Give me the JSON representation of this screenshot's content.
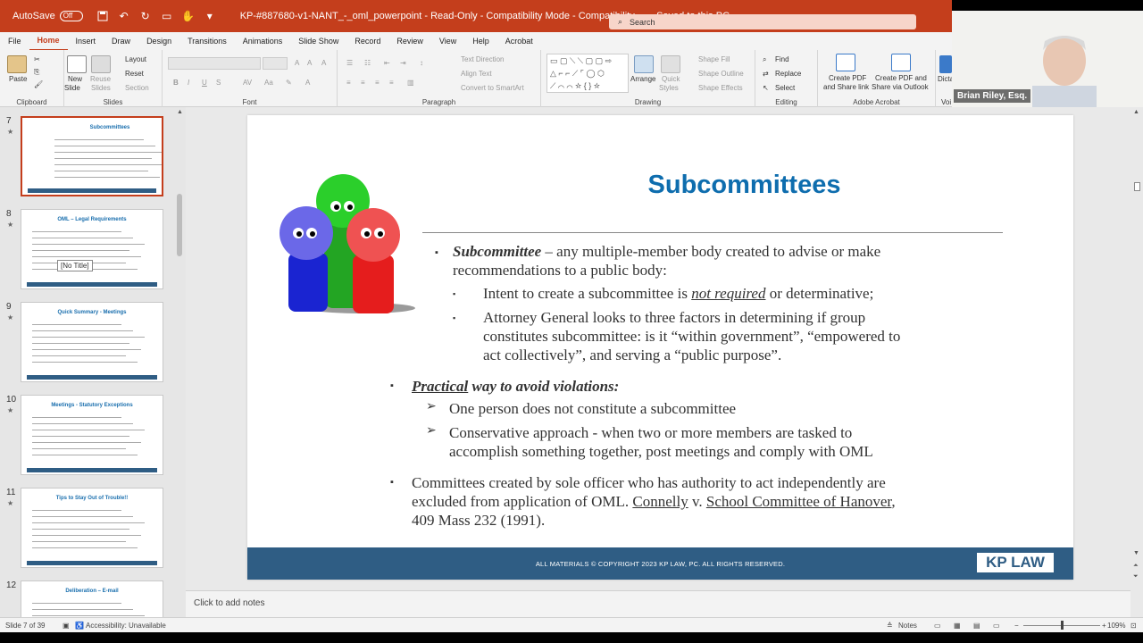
{
  "titlebar": {
    "autosave_label": "AutoSave",
    "autosave_state": "Off",
    "file_title": "KP-#887680-v1-NANT_-_oml_powerpoint  -  Read-Only  -  Compatibility Mode  -  Compatibility...",
    "saved_status": "Saved to this PC",
    "search_placeholder": "Search",
    "brand_color": "#c43e1c"
  },
  "tabs": [
    "File",
    "Home",
    "Insert",
    "Draw",
    "Design",
    "Transitions",
    "Animations",
    "Slide Show",
    "Record",
    "Review",
    "View",
    "Help",
    "Acrobat"
  ],
  "active_tab": "Home",
  "ribbon": {
    "clipboard": {
      "paste": "Paste",
      "label": "Clipboard"
    },
    "slides": {
      "new_slide_1": "New",
      "new_slide_2": "Slide",
      "reuse_1": "Reuse",
      "reuse_2": "Slides",
      "layout": "Layout",
      "reset": "Reset",
      "section": "Section",
      "label": "Slides"
    },
    "font": {
      "label": "Font"
    },
    "paragraph": {
      "text_direction": "Text Direction",
      "align_text": "Align Text",
      "convert_smartart": "Convert to SmartArt",
      "label": "Paragraph"
    },
    "drawing": {
      "arrange": "Arrange",
      "quick_styles_1": "Quick",
      "quick_styles_2": "Styles",
      "shape_fill": "Shape Fill",
      "shape_outline": "Shape Outline",
      "shape_effects": "Shape Effects",
      "label": "Drawing"
    },
    "editing": {
      "find": "Find",
      "replace": "Replace",
      "select": "Select",
      "label": "Editing"
    },
    "acrobat": {
      "create_pdf_1": "Create PDF",
      "create_pdf_2": "and Share link",
      "create_outlook_1": "Create PDF and",
      "create_outlook_2": "Share via Outlook",
      "label": "Adobe Acrobat"
    },
    "dictate": {
      "label_1": "Dicta",
      "label_2": "Voi"
    }
  },
  "video": {
    "participant_name": "Brian Riley, Esq."
  },
  "thumbnails": [
    {
      "num": "7",
      "star": "★",
      "title": "Subcommittees"
    },
    {
      "num": "8",
      "star": "★",
      "title": "OML – Legal Requirements",
      "tooltip": "[No Title]"
    },
    {
      "num": "9",
      "star": "★",
      "title": "Quick Summary - Meetings"
    },
    {
      "num": "10",
      "star": "★",
      "title": "Meetings - Statutory Exceptions"
    },
    {
      "num": "11",
      "star": "★",
      "title": "Tips to Stay Out of Trouble!!"
    },
    {
      "num": "12",
      "star": "",
      "title": "Deliberation – E-mail"
    }
  ],
  "slide": {
    "title": "Subcommittees",
    "b1_term": "Subcommittee",
    "b1_rest": " – any multiple-member body created to advise or make",
    "b1_line2": "recommendations to a public body:",
    "b1a_pre": "Intent to create a subcommittee is ",
    "b1a_em": "not required",
    "b1a_post": " or determinative;",
    "b1b_line1": "Attorney General looks to three factors in determining if group",
    "b1b_line2": "constitutes subcommittee: is it “within government”, “empowered to",
    "b1b_line3": "act collectively”, and serving a “public purpose”.",
    "b2_em": "Practical",
    "b2_rest": " way to avoid violations:",
    "b2a": "One person does not constitute a subcommittee",
    "b2b_line1": "Conservative approach - when two or more members are tasked to",
    "b2b_line2": "accomplish something together, post meetings and comply with OML",
    "b3_line1": "Committees created by sole officer who has authority to act independently are",
    "b3_line2_pre": "excluded from application of  OML.  ",
    "b3_case1": "Connelly",
    "b3_v": " v. ",
    "b3_case2": "School Committee of Hanover",
    "b3_line2_post": ",",
    "b3_line3": "409 Mass 232 (1991).",
    "footer": "ALL MATERIALS © COPYRIGHT  2023  KP LAW, PC.  ALL RIGHTS RESERVED.",
    "logo": "KP LAW"
  },
  "notes_placeholder": "Click to add notes",
  "status": {
    "slide_of": "Slide 7 of 39",
    "accessibility": "Accessibility: Unavailable",
    "notes": "Notes",
    "zoom": "109%"
  }
}
